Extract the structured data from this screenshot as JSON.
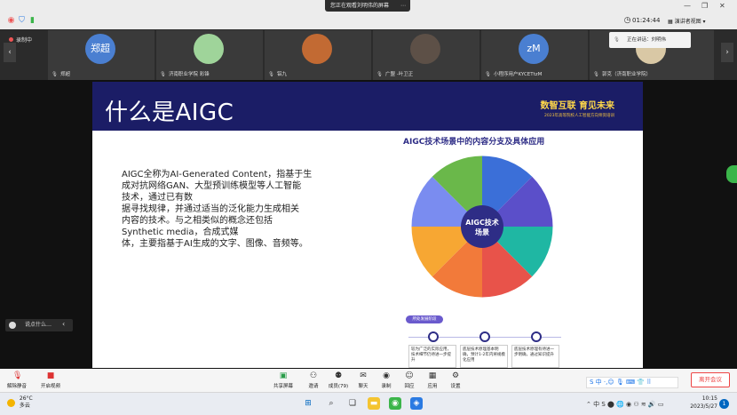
{
  "top_bar": {
    "viewing_label": "您正在观看刘明伟的屏幕",
    "clock": "01:24:44",
    "view_mode": "演讲者视图"
  },
  "participants": [
    {
      "name": "郑超",
      "avatar_text": "郑超",
      "avatar_color": "#4a7fd1"
    },
    {
      "name": "济南职业学院  彩锋",
      "avatar_text": "",
      "avatar_color": "#9fd49a"
    },
    {
      "name": "铝九",
      "avatar_text": "",
      "avatar_color": "#c26a33"
    },
    {
      "name": "广盟 -叶卫正",
      "avatar_text": "",
      "avatar_color": "#5d5047"
    },
    {
      "name": "小程序用户KYCETtzM",
      "avatar_text": "zM",
      "avatar_color": "#4a7fd1"
    },
    {
      "name": "郭克（济南职业学院）",
      "avatar_text": "",
      "avatar_color": "#d9c8a5"
    }
  ],
  "recording_label": "录制中",
  "speaking": {
    "label": "正在讲话：刘明伟"
  },
  "slide": {
    "title": "什么是AIGC",
    "brand": "数智互联  育见未来",
    "brand_sub": "2023年高等院校人工智能方向师资培训",
    "body_lines": [
      "AIGC全称为AI-Generated Content，指基于生",
      "成对抗网络GAN、大型预训练模型等人工智能",
      "技术，通过已有数",
      "据寻找规律，并通过适当的泛化能力生成相关",
      "内容的技术。与之相类似的概念还包括",
      "Synthetic media，合成式媒",
      "体，主要指基于AI生成的文字、图像、音频等。"
    ],
    "panel_title": "AIGC技术场景中的内容分支及具体应用",
    "wheel_center": [
      "AIGC技术",
      "场景"
    ],
    "flow_tag": "所处发展阶段",
    "flow_boxes": [
      "较为广泛的实际应用，技术细节仍待进一步提升",
      "底层技术原理基本明确，预计1-2年内将规模化应用",
      "底层技术原理有待进一步明确，通过知识提升"
    ]
  },
  "chat": {
    "placeholder": "说点什么…"
  },
  "toolbar": {
    "mute": "解除静音",
    "video": "开启视频",
    "share": "共享屏幕",
    "invite": "邀请",
    "members": "成员(79)",
    "chat": "聊天",
    "record": "录制",
    "reactions": "回应",
    "apps": "应用",
    "settings": "设置",
    "leave": "离开会议"
  },
  "taskbar": {
    "temperature": "26°C",
    "weather": "多云",
    "time": "10:15",
    "date": "2023/5/27",
    "notifications": "1"
  },
  "colors": {
    "slide_header": "#1b1d66",
    "brand_yellow": "#ffd84a",
    "leave_red": "#e44444"
  }
}
